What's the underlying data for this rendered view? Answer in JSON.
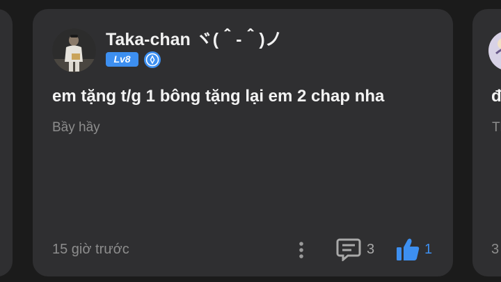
{
  "post": {
    "username": "Taka-chan ヾ(＾-＾)ノ",
    "level": "Lv8",
    "content": "em tặng t/g 1 bông tặng lại em 2 chap nha",
    "subtext": "Bầy hầy",
    "timestamp": "15 giờ trước",
    "comment_count": "3",
    "like_count": "1",
    "accent_color": "#3d8ff0"
  },
  "next_post_peek": {
    "content_fragment": "đ",
    "subtext_fragment": "Tl",
    "count_fragment": "3"
  }
}
